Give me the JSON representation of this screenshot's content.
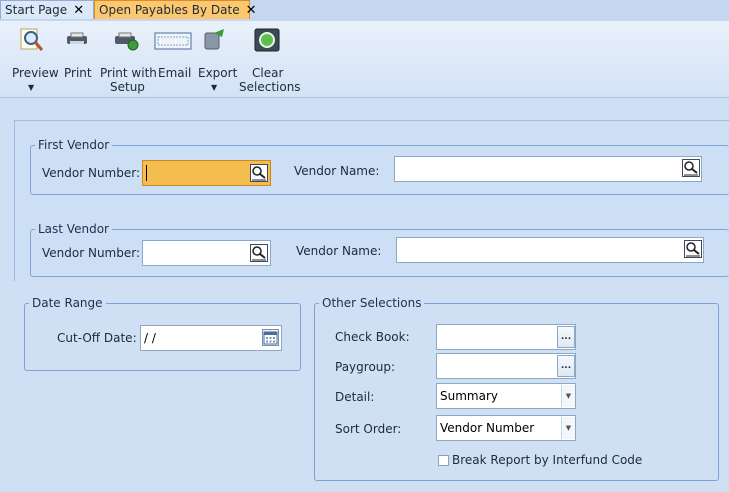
{
  "tabs": [
    {
      "label": "Start Page",
      "close": "✕"
    },
    {
      "label": "Open Payables By Date",
      "close": "✕"
    }
  ],
  "toolbar": {
    "preview": "Preview",
    "print": "Print",
    "print_setup_1": "Print with",
    "print_setup_2": "Setup",
    "email": "Email",
    "export": "Export",
    "clear_1": "Clear",
    "clear_2": "Selections",
    "dropdown_arrow": "▼"
  },
  "first_vendor": {
    "legend": "First Vendor",
    "number_label": "Vendor Number:",
    "number_value": "",
    "name_label": "Vendor Name:",
    "name_value": ""
  },
  "last_vendor": {
    "legend": "Last Vendor",
    "number_label": "Vendor Number:",
    "number_value": "",
    "name_label": "Vendor Name:",
    "name_value": ""
  },
  "date_range": {
    "legend": "Date Range",
    "cutoff_label": "Cut-Off Date:",
    "cutoff_value": "/ /"
  },
  "other": {
    "legend": "Other Selections",
    "checkbook_label": "Check Book:",
    "checkbook_value": "",
    "paygroup_label": "Paygroup:",
    "paygroup_value": "",
    "detail_label": "Detail:",
    "detail_value": "Summary",
    "sort_label": "Sort Order:",
    "sort_value": "Vendor Number",
    "ellipsis": "...",
    "dropdown_arrow": "▼",
    "break_label": "Break Report by Interfund Code",
    "break_checked": false
  }
}
